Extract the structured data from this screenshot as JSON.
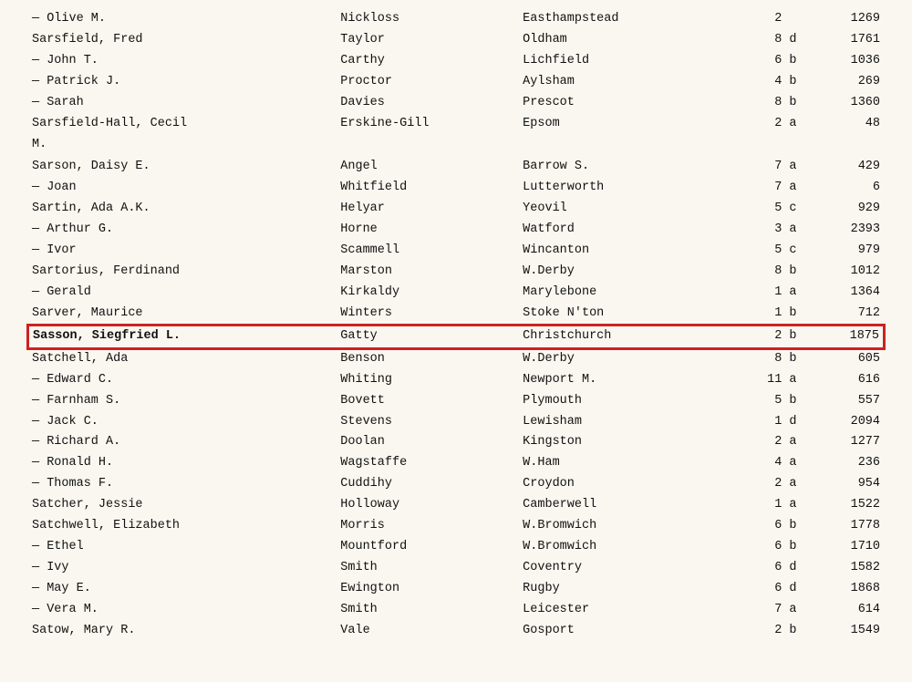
{
  "rows": [
    {
      "name": "— Olive M.",
      "agent": "Nickloss",
      "place": "Easthampstead",
      "div": "2",
      "sec": "",
      "num": "1269",
      "highlighted": false
    },
    {
      "name": "Sarsfield, Fred",
      "agent": "Taylor",
      "place": "Oldham",
      "div": "8",
      "sec": "d",
      "num": "1761",
      "highlighted": false
    },
    {
      "name": "— John T.",
      "agent": "Carthy",
      "place": "Lichfield",
      "div": "6",
      "sec": "b",
      "num": "1036",
      "highlighted": false
    },
    {
      "name": "— Patrick J.",
      "agent": "Proctor",
      "place": "Aylsham",
      "div": "4",
      "sec": "b",
      "num": "269",
      "highlighted": false
    },
    {
      "name": "— Sarah",
      "agent": "Davies",
      "place": "Prescot",
      "div": "8",
      "sec": "b",
      "num": "1360",
      "highlighted": false
    },
    {
      "name": "Sarsfield-Hall, Cecil",
      "agent": "Erskine-Gill",
      "place": "Epsom",
      "div": "2",
      "sec": "a",
      "num": "48",
      "highlighted": false
    },
    {
      "name": "        M.",
      "agent": "",
      "place": "",
      "div": "",
      "sec": "",
      "num": "",
      "highlighted": false
    },
    {
      "name": "",
      "agent": "",
      "place": "",
      "div": "",
      "sec": "",
      "num": "",
      "highlighted": false
    },
    {
      "name": "Sarson, Daisy E.",
      "agent": "Angel",
      "place": "Barrow S.",
      "div": "7",
      "sec": "a",
      "num": "429",
      "highlighted": false
    },
    {
      "name": "— Joan",
      "agent": "Whitfield",
      "place": "Lutterworth",
      "div": "7",
      "sec": "a",
      "num": "6",
      "highlighted": false
    },
    {
      "name": "Sartin, Ada A.K.",
      "agent": "Helyar",
      "place": "Yeovil",
      "div": "5",
      "sec": "c",
      "num": "929",
      "highlighted": false
    },
    {
      "name": "— Arthur G.",
      "agent": "Horne",
      "place": "Watford",
      "div": "3",
      "sec": "a",
      "num": "2393",
      "highlighted": false
    },
    {
      "name": "— Ivor",
      "agent": "Scammell",
      "place": "Wincanton",
      "div": "5",
      "sec": "c",
      "num": "979",
      "highlighted": false
    },
    {
      "name": "Sartorius, Ferdinand",
      "agent": "Marston",
      "place": "W.Derby",
      "div": "8",
      "sec": "b",
      "num": "1012",
      "highlighted": false
    },
    {
      "name": "— Gerald",
      "agent": "Kirkaldy",
      "place": "Marylebone",
      "div": "1",
      "sec": "a",
      "num": "1364",
      "highlighted": false
    },
    {
      "name": "Sarver, Maurice",
      "agent": "Winters",
      "place": "Stoke N'ton",
      "div": "1",
      "sec": "b",
      "num": "712",
      "highlighted": false
    },
    {
      "name": "Sasson, Siegfried L.",
      "agent": "Gatty",
      "place": "Christchurch",
      "div": "2",
      "sec": "b",
      "num": "1875",
      "highlighted": true
    },
    {
      "name": "Satchell, Ada",
      "agent": "Benson",
      "place": "W.Derby",
      "div": "8",
      "sec": "b",
      "num": "605",
      "highlighted": false
    },
    {
      "name": "— Edward C.",
      "agent": "Whiting",
      "place": "Newport M.",
      "div": "11",
      "sec": "a",
      "num": "616",
      "highlighted": false
    },
    {
      "name": "— Farnham S.",
      "agent": "Bovett",
      "place": "Plymouth",
      "div": "5",
      "sec": "b",
      "num": "557",
      "highlighted": false
    },
    {
      "name": "— Jack C.",
      "agent": "Stevens",
      "place": "Lewisham",
      "div": "1",
      "sec": "d",
      "num": "2094",
      "highlighted": false
    },
    {
      "name": "— Richard A.",
      "agent": "Doolan",
      "place": "Kingston",
      "div": "2",
      "sec": "a",
      "num": "1277",
      "highlighted": false
    },
    {
      "name": "— Ronald H.",
      "agent": "Wagstaffe",
      "place": "W.Ham",
      "div": "4",
      "sec": "a",
      "num": "236",
      "highlighted": false
    },
    {
      "name": "— Thomas F.",
      "agent": "Cuddihy",
      "place": "Croydon",
      "div": "2",
      "sec": "a",
      "num": "954",
      "highlighted": false
    },
    {
      "name": "Satcher, Jessie",
      "agent": "Holloway",
      "place": "Camberwell",
      "div": "1",
      "sec": "a",
      "num": "1522",
      "highlighted": false
    },
    {
      "name": "Satchwell, Elizabeth",
      "agent": "Morris",
      "place": "W.Bromwich",
      "div": "6",
      "sec": "b",
      "num": "1778",
      "highlighted": false
    },
    {
      "name": "— Ethel",
      "agent": "Mountford",
      "place": "W.Bromwich",
      "div": "6",
      "sec": "b",
      "num": "1710",
      "highlighted": false
    },
    {
      "name": "— Ivy",
      "agent": "Smith",
      "place": "Coventry",
      "div": "6",
      "sec": "d",
      "num": "1582",
      "highlighted": false
    },
    {
      "name": "— May E.",
      "agent": "Ewington",
      "place": "Rugby",
      "div": "6",
      "sec": "d",
      "num": "1868",
      "highlighted": false
    },
    {
      "name": "— Vera M.",
      "agent": "Smith",
      "place": "Leicester",
      "div": "7",
      "sec": "a",
      "num": "614",
      "highlighted": false
    },
    {
      "name": "Satow, Mary R.",
      "agent": "Vale",
      "place": "Gosport",
      "div": "2",
      "sec": "b",
      "num": "1549",
      "highlighted": false
    }
  ]
}
